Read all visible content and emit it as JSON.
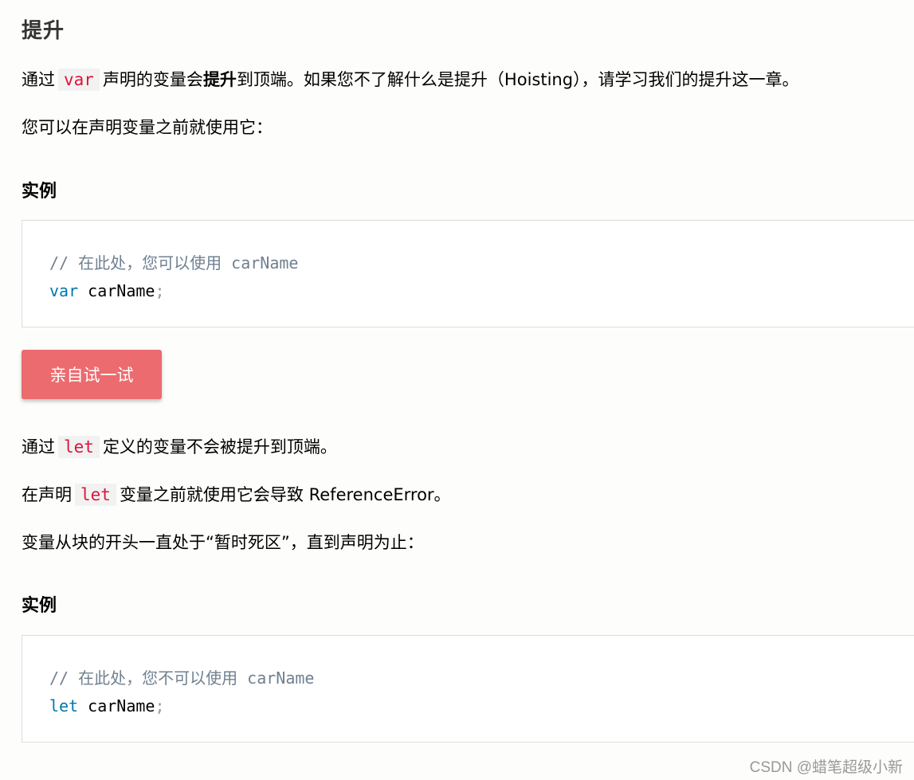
{
  "heading": "提升",
  "para1": {
    "prefix": "通过",
    "code": "var",
    "mid": "声明的变量会",
    "bold": "提升",
    "suffix": "到顶端。如果您不了解什么是提升（Hoisting），请学习我们的提升这一章。"
  },
  "para2": "您可以在声明变量之前就使用它：",
  "example1": {
    "label": "实例",
    "comment": "// 在此处，您可以使用 carName",
    "keyword": "var",
    "ident": " carName",
    "punct": ";"
  },
  "try_button": "亲自试一试",
  "para3": {
    "prefix": "通过",
    "code": "let",
    "suffix": "定义的变量不会被提升到顶端。"
  },
  "para4": {
    "prefix": "在声明",
    "code": "let",
    "suffix": "变量之前就使用它会导致 ReferenceError。"
  },
  "para5": "变量从块的开头一直处于“暂时死区”，直到声明为止：",
  "example2": {
    "label": "实例",
    "comment": "// 在此处，您不可以使用 carName",
    "keyword": "let",
    "ident": " carName",
    "punct": ";"
  },
  "watermark": "CSDN @蜡笔超级小新",
  "colors": {
    "button_bg": "#ec6b6e",
    "inline_code": "#dc143c",
    "keyword": "#0077aa",
    "comment": "#708090"
  }
}
